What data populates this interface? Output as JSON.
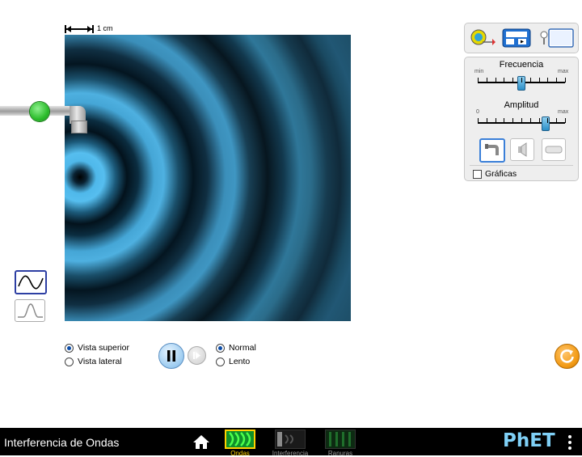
{
  "sim": {
    "title": "Interferencia de Ondas"
  },
  "scale": {
    "label": "1 cm"
  },
  "controls": {
    "frequency": {
      "title": "Frecuencia",
      "min_label": "min",
      "max_label": "max",
      "value_fraction": 0.5
    },
    "amplitude": {
      "title": "Amplitud",
      "min_label": "0",
      "max_label": "max",
      "value_fraction": 0.78
    },
    "graphs_checkbox": {
      "label": "Gráficas",
      "checked": false
    }
  },
  "view": {
    "top_label": "Vista superior",
    "side_label": "Vista lateral",
    "selected": "top"
  },
  "speed": {
    "normal_label": "Normal",
    "slow_label": "Lento",
    "selected": "normal"
  },
  "screens": [
    {
      "label": "Ondas",
      "active": true
    },
    {
      "label": "Interferencia",
      "active": false
    },
    {
      "label": "Ranuras",
      "active": false
    }
  ],
  "brand": {
    "logo": "PhET"
  },
  "colors": {
    "active_screen": "#ffd200",
    "inactive_screen": "#9a9a9a",
    "water": "#4fb8ea",
    "reset": "#f29a14"
  },
  "icons": [
    "measuring-tape-icon",
    "stopwatch-icon",
    "wave-meter-icon",
    "faucet-icon",
    "speaker-icon",
    "laser-icon",
    "home-icon",
    "menu-icon",
    "reset-icon",
    "play-pause-icon",
    "step-forward-icon"
  ]
}
